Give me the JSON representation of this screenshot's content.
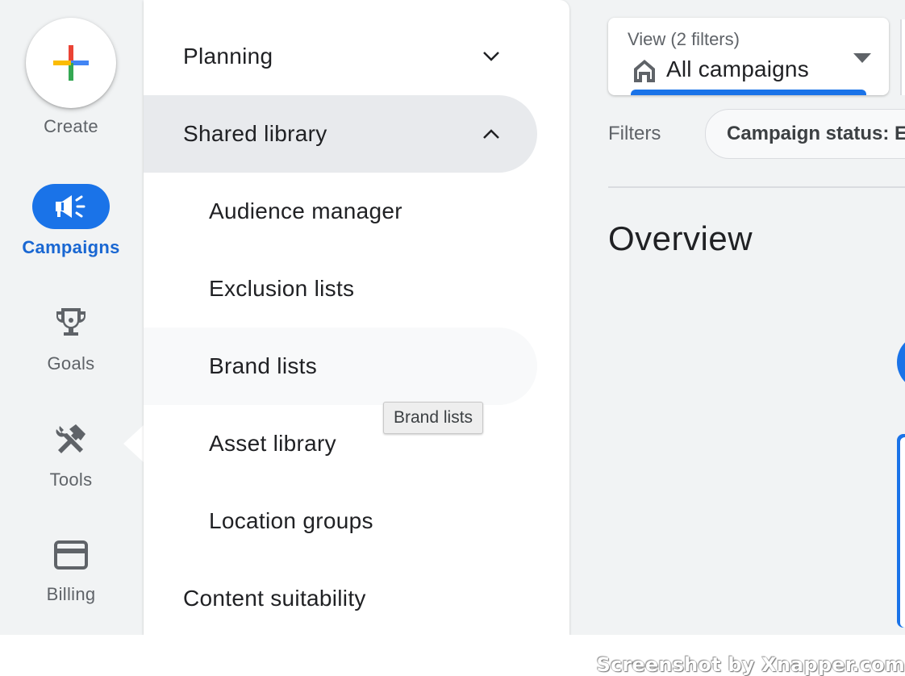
{
  "rail": {
    "create_label": "Create",
    "items": [
      {
        "label": "Campaigns",
        "icon": "megaphone-icon",
        "active": true
      },
      {
        "label": "Goals",
        "icon": "trophy-icon"
      },
      {
        "label": "Tools",
        "icon": "tools-icon"
      },
      {
        "label": "Billing",
        "icon": "credit-card-icon"
      }
    ]
  },
  "menu": {
    "planning": "Planning",
    "shared_library": "Shared library",
    "audience_manager": "Audience manager",
    "exclusion_lists": "Exclusion lists",
    "brand_lists": "Brand lists",
    "asset_library": "Asset library",
    "location_groups": "Location groups",
    "content_suitability": "Content suitability"
  },
  "tooltip": "Brand lists",
  "view": {
    "label": "View (2 filters)",
    "value": "All campaigns"
  },
  "filters": {
    "label": "Filters",
    "chip": "Campaign status: E"
  },
  "main": {
    "title": "Overview"
  },
  "watermark": "Screenshot by Xnapper.com",
  "colors": {
    "accent": "#1a73e8",
    "active_text": "#1967d2",
    "rail_bg": "#f1f3f4",
    "selected_row": "#e8eaed"
  }
}
